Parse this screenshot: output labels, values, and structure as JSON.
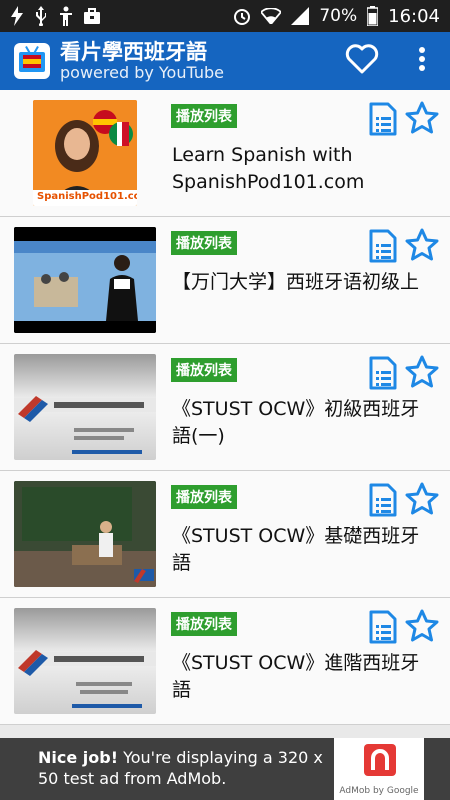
{
  "status_bar": {
    "battery_percent": "70%",
    "time": "16:04",
    "icons": [
      "flash-icon",
      "usb-icon",
      "accessibility-icon",
      "briefcase-icon",
      "alarm-icon",
      "wifi-icon",
      "signal-icon",
      "battery-icon"
    ]
  },
  "app_bar": {
    "title": "看片學西班牙語",
    "subtitle": "powered by YouTube",
    "actions": [
      "heart-icon",
      "more-vert-icon"
    ]
  },
  "playlist_badge": "播放列表",
  "items": [
    {
      "title": "Learn Spanish with SpanishPod101.com",
      "thumb_text": "SpanishPod101.com"
    },
    {
      "title": "【万门大学】西班牙语初级上",
      "thumb_text": ""
    },
    {
      "title": "《STUST OCW》初級西班牙語(一)",
      "thumb_text": ""
    },
    {
      "title": "《STUST OCW》基礎西班牙語",
      "thumb_text": ""
    },
    {
      "title": "《STUST OCW》進階西班牙語",
      "thumb_text": ""
    }
  ],
  "ad": {
    "bold": "Nice job!",
    "text": " You're displaying a 320 x 50 test ad from AdMob.",
    "brand": "AdMob by Google"
  },
  "colors": {
    "app_bar": "#1565c0",
    "badge": "#2e9e2e",
    "icon_blue": "#1e88e5"
  }
}
